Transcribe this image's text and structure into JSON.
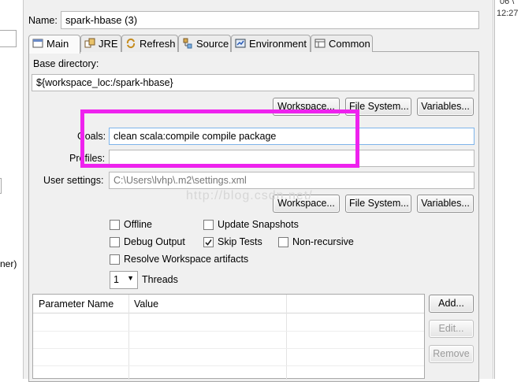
{
  "left_panel": {
    "partial_text": "ner)"
  },
  "right_panel": {
    "partial_top": "06 \\",
    "partial_time": "12:27"
  },
  "name": {
    "label": "Name:",
    "value": "spark-hbase (3)"
  },
  "tabs": [
    {
      "label": "Main",
      "icon": "main-icon"
    },
    {
      "label": "JRE",
      "icon": "jre-icon"
    },
    {
      "label": "Refresh",
      "icon": "refresh-icon"
    },
    {
      "label": "Source",
      "icon": "source-icon"
    },
    {
      "label": "Environment",
      "icon": "environment-icon"
    },
    {
      "label": "Common",
      "icon": "common-icon"
    }
  ],
  "base_directory": {
    "label": "Base directory:",
    "value": "${workspace_loc:/spark-hbase}",
    "buttons": [
      "Workspace...",
      "File System...",
      "Variables..."
    ]
  },
  "goals": {
    "label": "Goals:",
    "value": "clean scala:compile compile package"
  },
  "profiles": {
    "label": "Profiles:",
    "value": ""
  },
  "user_settings": {
    "label": "User settings:",
    "value": "C:\\Users\\lvhp\\.m2\\settings.xml",
    "buttons": [
      "Workspace...",
      "File System...",
      "Variables..."
    ]
  },
  "options": {
    "offline": {
      "label": "Offline",
      "checked": false
    },
    "update_snapshots": {
      "label": "Update Snapshots",
      "checked": false
    },
    "debug_output": {
      "label": "Debug Output",
      "checked": false
    },
    "skip_tests": {
      "label": "Skip Tests",
      "checked": true
    },
    "non_recursive": {
      "label": "Non-recursive",
      "checked": false
    },
    "resolve_workspace": {
      "label": "Resolve Workspace artifacts",
      "checked": false
    }
  },
  "threads": {
    "value": "1",
    "label": "Threads"
  },
  "parameters": {
    "columns": [
      "Parameter Name",
      "Value"
    ],
    "buttons": {
      "add": "Add...",
      "edit": "Edit...",
      "remove": "Remove"
    }
  },
  "watermark": "http://blog.csdn.net/",
  "colors": {
    "highlight": "#ee22ee",
    "dialog_bg": "#f0f0f0"
  }
}
